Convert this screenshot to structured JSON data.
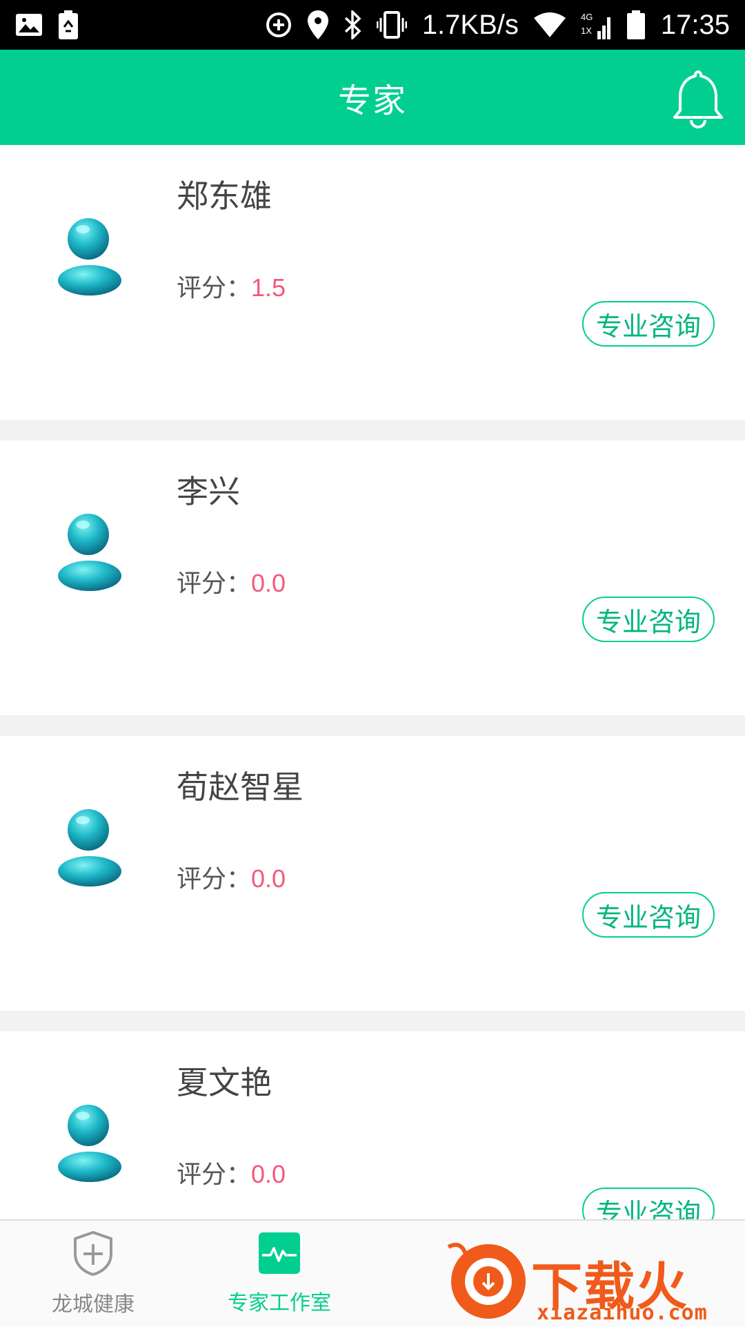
{
  "status_bar": {
    "speed": "1.7KB/s",
    "time": "17:35",
    "icons": [
      "image-icon",
      "battery-recycle-icon",
      "data-saver-icon",
      "location-icon",
      "bluetooth-icon",
      "vibrate-icon",
      "wifi-icon",
      "signal-4g-icon",
      "battery-icon"
    ]
  },
  "header": {
    "title": "专家",
    "bell_icon": "bell-icon"
  },
  "experts": [
    {
      "name": "郑东雄",
      "rating_label": "评分：",
      "rating": "1.5",
      "button": "专业咨询"
    },
    {
      "name": "李兴",
      "rating_label": "评分：",
      "rating": "0.0",
      "button": "专业咨询"
    },
    {
      "name": "荀赵智星",
      "rating_label": "评分：",
      "rating": "0.0",
      "button": "专业咨询"
    },
    {
      "name": "夏文艳",
      "rating_label": "评分：",
      "rating": "0.0",
      "button": "专业咨询"
    }
  ],
  "tabs": [
    {
      "label": "龙城健康",
      "icon": "shield-plus-icon",
      "active": false
    },
    {
      "label": "专家工作室",
      "icon": "heartbeat-icon",
      "active": true
    }
  ],
  "watermark": {
    "text": "下载火",
    "sub": "xiazaihuo.com"
  },
  "colors": {
    "brand_green": "#02cf8f",
    "rating_pink": "#f4587b",
    "divider": "#f2f2f2"
  }
}
